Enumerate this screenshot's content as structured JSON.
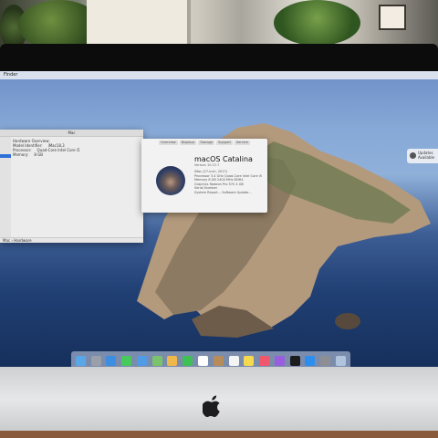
{
  "menubar": {
    "app": "Finder"
  },
  "notification": {
    "text": "Updates Available"
  },
  "system_info": {
    "title": "Mac",
    "rows": [
      {
        "label": "Hardware Overview:",
        "value": ""
      },
      {
        "label": "Model Identifier:",
        "value": "iMac18,3"
      },
      {
        "label": "Processor:",
        "value": "Quad-Core Intel Core i5"
      },
      {
        "label": "Memory:",
        "value": "8 GB"
      }
    ],
    "footer": "Mac › Hardware"
  },
  "about": {
    "tabs": [
      "Overview",
      "Displays",
      "Storage",
      "Support",
      "Service"
    ],
    "os_name": "macOS Catalina",
    "version": "Version 10.15.7",
    "specs": [
      "iMac (27-inch, 2017)",
      "Processor 3.4 GHz Quad-Core Intel Core i5",
      "Memory 8 GB 2400 MHz DDR4",
      "Graphics Radeon Pro 570 4 GB",
      "Serial Number",
      "System Report...   Software Update..."
    ]
  },
  "dock": {
    "apps": [
      "Finder",
      "Launchpad",
      "Safari",
      "Messages",
      "Mail",
      "Maps",
      "Photos",
      "FaceTime",
      "Calendar",
      "Contacts",
      "Reminders",
      "Notes",
      "Music",
      "Podcasts",
      "TV",
      "App Store",
      "System Preferences",
      "Trash"
    ]
  },
  "colors": {
    "sky": "#87a9d7",
    "sea": "#203f73",
    "dock": "#cdd7eb"
  }
}
